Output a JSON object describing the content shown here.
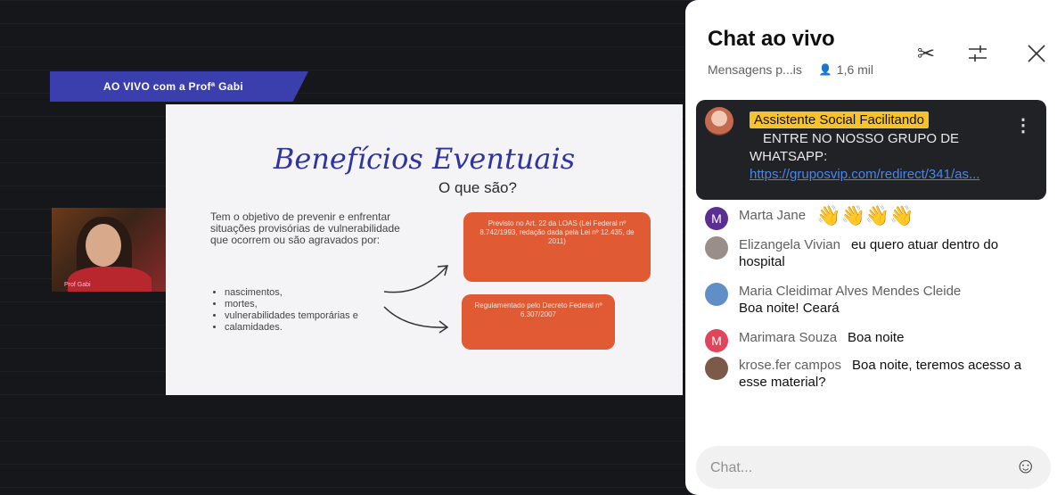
{
  "video": {
    "banner": "AO VIVO com a Profª Gabi",
    "webcam_tag": "Prof Gabi",
    "slide": {
      "title": "Benefícios Eventuais",
      "subtitle": "O que são?",
      "text": "Tem o objetivo de prevenir e enfrentar situações provisórias de vulnerabilidade que ocorrem ou são agravados por:",
      "bullets": [
        "nascimentos,",
        "mortes,",
        "vulnerabilidades temporárias e",
        "calamidades."
      ],
      "box1": "Previsto no Art. 22 da LOAS (Lei Federal nº 8.742/1993, redação dada pela Lei nº 12.435, de 2011)",
      "box2": "Regulamentado pelo Decreto Federal nº 6.307/2007"
    }
  },
  "chat": {
    "title": "Chat ao vivo",
    "mode": "Mensagens p...is",
    "viewers": "1,6 mil",
    "pinned": {
      "author": "Assistente Social Facilitando",
      "line1": "ENTRE NO NOSSO GRUPO DE",
      "line2_prefix": "WHATSAPP: ",
      "link": "https://gruposvip.com/redirect/341/as..."
    },
    "messages": [
      {
        "initial": "M",
        "color": "#5b2e92",
        "author": "Marta Jane",
        "text": "",
        "emoji": "👋👋👋👋"
      },
      {
        "initial": "",
        "color": "#9a8f88",
        "author": "Elizangela Vivian",
        "text": "eu quero atuar dentro do hospital",
        "emoji": ""
      },
      {
        "initial": "",
        "color": "#5f8fc6",
        "author": "Maria Cleidimar Alves Mendes Cleide",
        "text": "Boa noite! Ceará",
        "emoji": ""
      },
      {
        "initial": "M",
        "color": "#e0455a",
        "author": "Marimara Souza",
        "text": "Boa noite",
        "emoji": ""
      },
      {
        "initial": "",
        "color": "#7b5a4a",
        "author": "krose.fer campos",
        "text": "Boa noite, teremos acesso a esse material?",
        "emoji": ""
      }
    ],
    "input_placeholder": "Chat..."
  }
}
